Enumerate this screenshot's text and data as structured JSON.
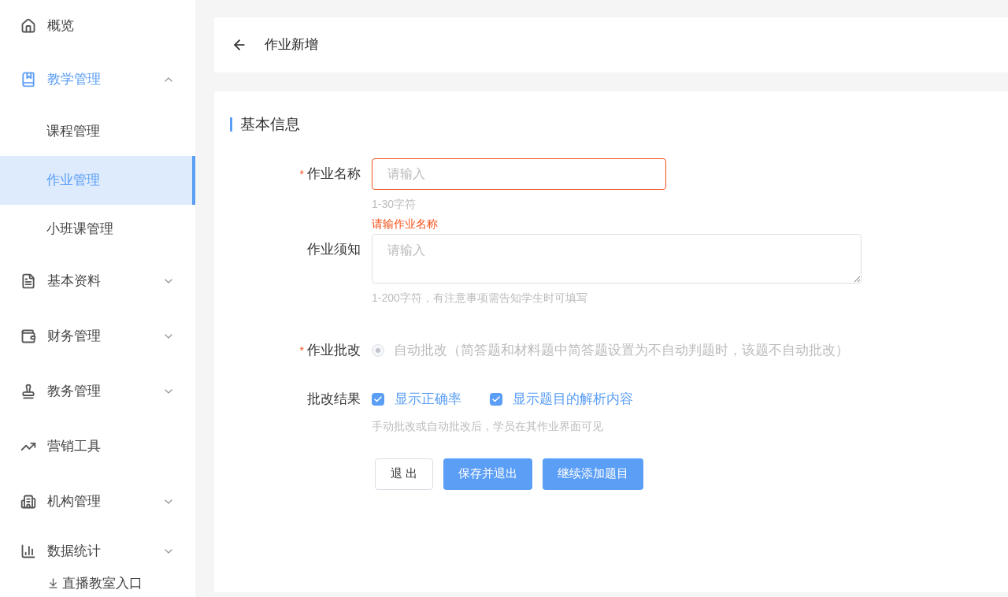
{
  "sidebar": {
    "items": [
      {
        "label": "概览",
        "selected": false
      },
      {
        "label": "教学管理",
        "selected": true,
        "expanded": true,
        "children": [
          {
            "label": "课程管理",
            "selected": false
          },
          {
            "label": "作业管理",
            "selected": true
          },
          {
            "label": "小班课管理",
            "selected": false
          }
        ]
      },
      {
        "label": "基本资料",
        "selected": false,
        "expanded": false
      },
      {
        "label": "财务管理",
        "selected": false,
        "expanded": false
      },
      {
        "label": "教务管理",
        "selected": false,
        "expanded": false
      },
      {
        "label": "营销工具",
        "selected": false
      },
      {
        "label": "机构管理",
        "selected": false,
        "expanded": false
      },
      {
        "label": "数据统计",
        "selected": false,
        "expanded": false
      }
    ],
    "footer_link": "直播教室入口"
  },
  "header": {
    "title": "作业新增"
  },
  "section": {
    "title": "基本信息"
  },
  "form": {
    "name": {
      "label": "作业名称",
      "required_mark": "*",
      "placeholder": "请输入",
      "hint": "1-30字符",
      "error": "请输作业名称"
    },
    "notice": {
      "label": "作业须知",
      "placeholder": "请输入",
      "hint": "1-200字符，有注意事项需告知学生时可填写"
    },
    "grading": {
      "label": "作业批改",
      "required_mark": "*",
      "options": [
        {
          "label": "自动批改（简答题和材料题中简答题设置为不自动判题时，该题不自动批改）",
          "selected": true,
          "disabled": true
        }
      ]
    },
    "result": {
      "label": "批改结果",
      "options": [
        {
          "label": "显示正确率",
          "checked": true
        },
        {
          "label": "显示题目的解析内容",
          "checked": true
        }
      ],
      "hint": "手动批改或自动批改后，学员在其作业界面可见"
    }
  },
  "buttons": [
    {
      "label": "退 出",
      "kind": "default"
    },
    {
      "label": "保存并退出",
      "kind": "primary"
    },
    {
      "label": "继续添加题目",
      "kind": "primary"
    }
  ]
}
